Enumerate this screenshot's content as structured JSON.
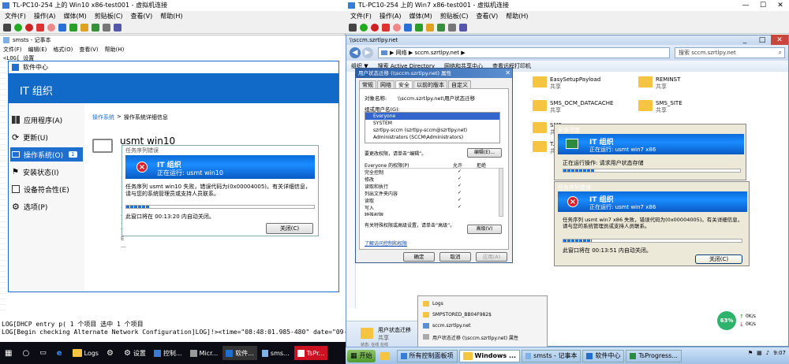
{
  "left_window": {
    "title": "TL-PC10-254 上的 Win10 x86-test001 - 虚拟机连接",
    "menu": [
      "文件(F)",
      "操作(A)",
      "媒体(M)",
      "剪贴板(C)",
      "查看(V)",
      "帮助(H)"
    ],
    "notepad_title": "smsts - 记事本",
    "notepad_menu": [
      "文件(F)",
      "编辑(E)",
      "格式(O)",
      "查看(V)",
      "帮助(H)"
    ],
    "notepad_first_line": "<LOG[ 设置",
    "log_lines": [
      "LOG[DHCP entry p( 1 个项目  选中 1 个项目",
      "LOG[Begin checking Alternate Network Configuration]LOG]!><time=\"08:48:01.985-480\" date=\"09-22-2016\""
    ],
    "software_center": {
      "title": "软件中心",
      "org": "IT 组织",
      "nav": [
        {
          "label": "应用程序(A)",
          "icon": "apps-icon"
        },
        {
          "label": "更新(U)",
          "icon": "refresh-icon"
        },
        {
          "label": "操作系统(O)",
          "icon": "os-icon",
          "badge": "1"
        },
        {
          "label": "安装状态(I)",
          "icon": "flag-icon"
        },
        {
          "label": "设备符合性(E)",
          "icon": "compliance-icon"
        },
        {
          "label": "选项(P)",
          "icon": "gear-icon"
        }
      ],
      "breadcrumb_link": "操作系统",
      "breadcrumb_sep": ">",
      "breadcrumb_current": "操作系统详细信息",
      "os_name": "usmt win10",
      "side_glimpse": [
        "—",
        "—",
        "—",
        "T",
        "E",
        "—"
      ]
    },
    "error_dialog": {
      "title": "任务序列错误",
      "org": "IT 组织",
      "running": "正在运行: usmt win10",
      "message": "任务序列 usmt win10 失败，错误代码为(0x00004005)。有关详细信息，请与您的系统管理员或支持人员联系。",
      "countdown": "此窗口将在 00:13:20 内自动关闭。",
      "close_label": "关闭(C)"
    },
    "taskbar": [
      {
        "label": "",
        "icon": "windows-start-icon"
      },
      {
        "label": "",
        "icon": "search-icon"
      },
      {
        "label": "",
        "icon": "task-view-icon"
      },
      {
        "label": "",
        "icon": "edge-icon"
      },
      {
        "label": "Logs",
        "icon": "folder-icon"
      },
      {
        "label": "",
        "icon": "gear-icon"
      },
      {
        "label": "设置",
        "icon": "gear-icon"
      },
      {
        "label": "控制...",
        "icon": "control-panel-icon"
      },
      {
        "label": "Micr...",
        "icon": "mmc-icon"
      },
      {
        "label": "软件...",
        "icon": "software-center-icon"
      },
      {
        "label": "sms...",
        "icon": "notepad-icon"
      },
      {
        "label": "TsPr...",
        "icon": "tsprogress-icon"
      }
    ]
  },
  "right_window": {
    "title": "TL-PC10-254 上的 Win7 x86-test001 - 虚拟机连接",
    "menu": [
      "文件(F)",
      "操作(A)",
      "媒体(M)",
      "剪贴板(C)",
      "查看(V)",
      "帮助(H)"
    ],
    "explorer_title": "\\\\sccm.szrtlpy.net",
    "address": "▶ 网络 ▶ sccm.szrtlpy.net ▶",
    "search_placeholder": "搜索 sccm.szrtlpy.net",
    "command_bar": [
      "组织 ▼",
      "搜索 Active Directory",
      "网络和共享中心",
      "查看远程打印机"
    ],
    "folders": [
      {
        "name": "EasySetupPayload",
        "sub": "共享"
      },
      {
        "name": "REMINST",
        "sub": "共享"
      },
      {
        "name": "SMS_OCM_DATACACHE",
        "sub": "共享"
      },
      {
        "name": "SMS_SITE",
        "sub": "共享"
      },
      {
        "name": "SMS...",
        "sub": "共享"
      },
      {
        "name": "T...",
        "sub": "共享"
      }
    ],
    "properties_dialog": {
      "title": "用户状态迁移 (\\\\sccm.szrtlpy.net) 属性",
      "tabs": [
        "常规",
        "网络",
        "安全",
        "以前的版本",
        "自定义"
      ],
      "object_label": "对象名称:",
      "object_value": "\\\\sccm.szrtlpy.net\\用户状态迁移",
      "group_label": "组或用户名(G):",
      "users": [
        "Everyone",
        "SYSTEM",
        "szrtlpy-sccm (szrtlpy-sccm@szrtlpy.net)",
        "Administrators (SCCM\\Administrators)"
      ],
      "change_hint": "要更改权限，请单击“编辑”。",
      "edit_label": "编辑(E)...",
      "perm_header": "Everyone 的权限(P)",
      "allow_header": "允许",
      "deny_header": "拒绝",
      "permissions": [
        {
          "name": "完全控制",
          "allow": "✓"
        },
        {
          "name": "修改",
          "allow": "✓"
        },
        {
          "name": "读取和执行",
          "allow": "✓"
        },
        {
          "name": "列出文件夹内容",
          "allow": "✓"
        },
        {
          "name": "读取",
          "allow": "✓"
        },
        {
          "name": "写入",
          "allow": "✓"
        },
        {
          "name": "特殊权限",
          "allow": ""
        }
      ],
      "special_hint": "有关特殊权限或高级设置，请单击“高级”。",
      "advanced_label": "高级(V)",
      "learn_link": "了解访问控制和权限",
      "ok_label": "确定",
      "cancel_label": "取消",
      "apply_label": "应用(A)"
    },
    "install_progress": {
      "title": "安装进度",
      "org": "IT 组织",
      "running": "正在运行: usmt win7 x86",
      "operation": "正在运行操作: 请求用户状态存储"
    },
    "error_dialog": {
      "title": "任务序列错误",
      "org": "IT 组织",
      "running": "正在运行: usmt win7 x86",
      "message": "任务序列 usmt win7 x86 失败，错误代码为(0x00004005)。有关详细信息，请与您的系统管理员或支持人员联系。",
      "countdown": "此窗口将在 00:13:51 内自动关闭。",
      "close_label": "关闭(C)"
    },
    "explorer_lower": {
      "items": [
        "Logs",
        "SMPSTORED_BB04F982$",
        "sccm.szrtlpy.net",
        "用户状态迁移 (\\\\sccm.szrtlpy.net) 属性"
      ],
      "folder_name": "用户状态迁移",
      "folder_sub": "共享",
      "status": "状态: 在线 在线"
    },
    "net_widget": {
      "percent": "63%",
      "up": "0K/s",
      "down": "0K/s"
    },
    "taskbar": [
      {
        "label": "开始",
        "icon": "start-orb-icon"
      },
      {
        "label": "",
        "icon": "explorer-icon"
      },
      {
        "label": "所有控制面板项",
        "icon": "control-panel-icon"
      },
      {
        "label": "Windows ...",
        "icon": "explorer-icon"
      },
      {
        "label": "smsts - 记事本",
        "icon": "notepad-icon"
      },
      {
        "label": "软件中心",
        "icon": "software-center-icon"
      },
      {
        "label": "TsProgress...",
        "icon": "tsprogress-icon"
      }
    ],
    "clock": "9:07"
  }
}
